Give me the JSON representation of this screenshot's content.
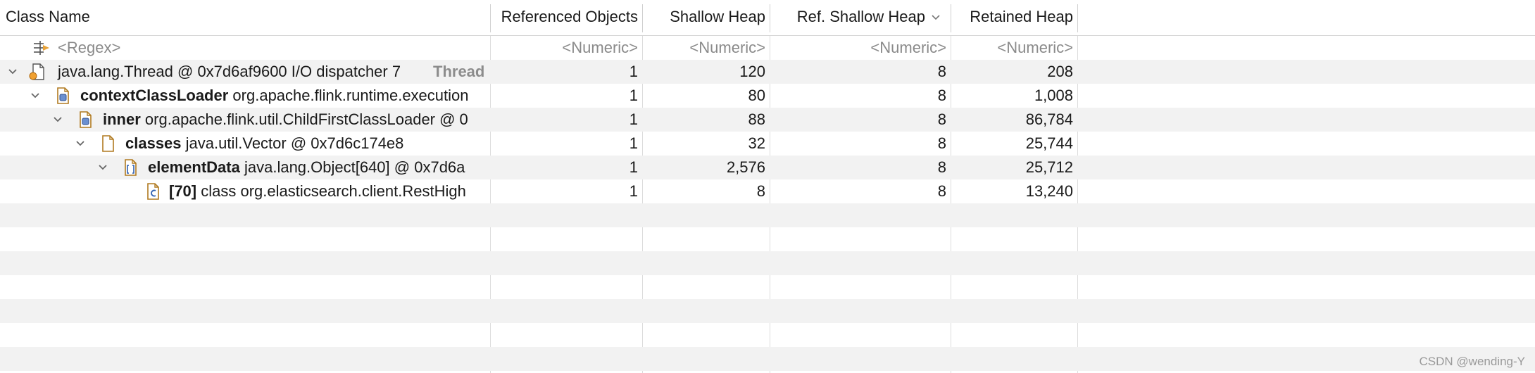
{
  "columns": {
    "class_name": "Class Name",
    "referenced_objects": "Referenced Objects",
    "shallow_heap": "Shallow Heap",
    "ref_shallow_heap": "Ref. Shallow Heap",
    "retained_heap": "Retained Heap"
  },
  "filter_row": {
    "name": "<Regex>",
    "referenced_objects": "<Numeric>",
    "shallow_heap": "<Numeric>",
    "ref_shallow_heap": "<Numeric>",
    "retained_heap": "<Numeric>"
  },
  "rows": [
    {
      "field": "",
      "text": "java.lang.Thread @ 0x7d6af9600  I/O dispatcher 7",
      "suffix": "Thread",
      "referenced_objects": "1",
      "shallow_heap": "120",
      "ref_shallow_heap": "8",
      "retained_heap": "208",
      "icon": "thread-object-icon"
    },
    {
      "field": "contextClassLoader",
      "text": "org.apache.flink.runtime.execution",
      "suffix": "",
      "referenced_objects": "1",
      "shallow_heap": "80",
      "ref_shallow_heap": "8",
      "retained_heap": "1,008",
      "icon": "classloader-object-icon"
    },
    {
      "field": "inner",
      "text": "org.apache.flink.util.ChildFirstClassLoader @ 0",
      "suffix": "",
      "referenced_objects": "1",
      "shallow_heap": "88",
      "ref_shallow_heap": "8",
      "retained_heap": "86,784",
      "icon": "classloader-object-icon"
    },
    {
      "field": "classes",
      "text": "java.util.Vector @ 0x7d6c174e8",
      "suffix": "",
      "referenced_objects": "1",
      "shallow_heap": "32",
      "ref_shallow_heap": "8",
      "retained_heap": "25,744",
      "icon": "object-icon"
    },
    {
      "field": "elementData",
      "text": "java.lang.Object[640] @ 0x7d6a",
      "suffix": "",
      "referenced_objects": "1",
      "shallow_heap": "2,576",
      "ref_shallow_heap": "8",
      "retained_heap": "25,712",
      "icon": "array-object-icon"
    },
    {
      "field": "[70]",
      "text": "class org.elasticsearch.client.RestHigh",
      "suffix": "",
      "referenced_objects": "1",
      "shallow_heap": "8",
      "ref_shallow_heap": "8",
      "retained_heap": "13,240",
      "icon": "class-icon"
    }
  ],
  "watermark": "CSDN @wending-Y"
}
